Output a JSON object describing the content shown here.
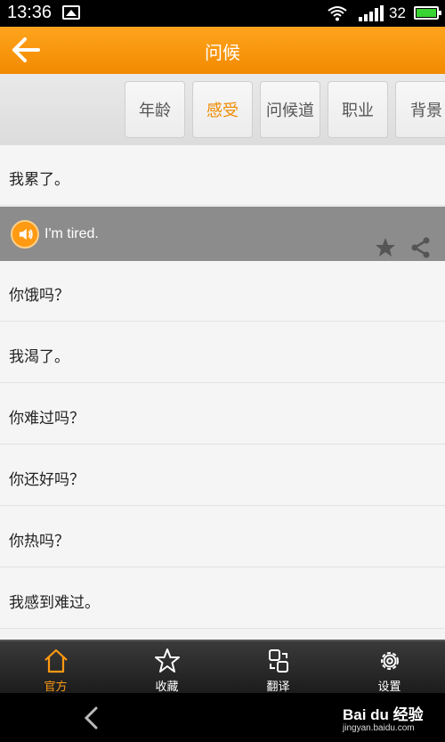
{
  "status_bar": {
    "time": "13:36",
    "battery_level": "32"
  },
  "header": {
    "title": "问候"
  },
  "tabs": [
    {
      "label": "年龄",
      "active": false
    },
    {
      "label": "感受",
      "active": true
    },
    {
      "label": "问候道",
      "active": false
    },
    {
      "label": "职业",
      "active": false
    },
    {
      "label": "背景",
      "active": false
    }
  ],
  "phrases": [
    "我累了。",
    "你饿吗？",
    "我渴了。",
    "你难过吗？",
    "你还好吗？",
    "你热吗？",
    "我感到难过。"
  ],
  "expanded": {
    "translation": "I'm tired."
  },
  "bottom_nav": [
    {
      "label": "官方",
      "icon": "home-icon",
      "active": true
    },
    {
      "label": "收藏",
      "icon": "star-icon",
      "active": false
    },
    {
      "label": "翻译",
      "icon": "translate-icon",
      "active": false
    },
    {
      "label": "设置",
      "icon": "gear-icon",
      "active": false
    }
  ],
  "watermark": {
    "brand": "Bai du 经验",
    "url": "jingyan.baidu.com"
  },
  "colors": {
    "accent": "#f28a00",
    "active_tab_text": "#f08a00"
  }
}
